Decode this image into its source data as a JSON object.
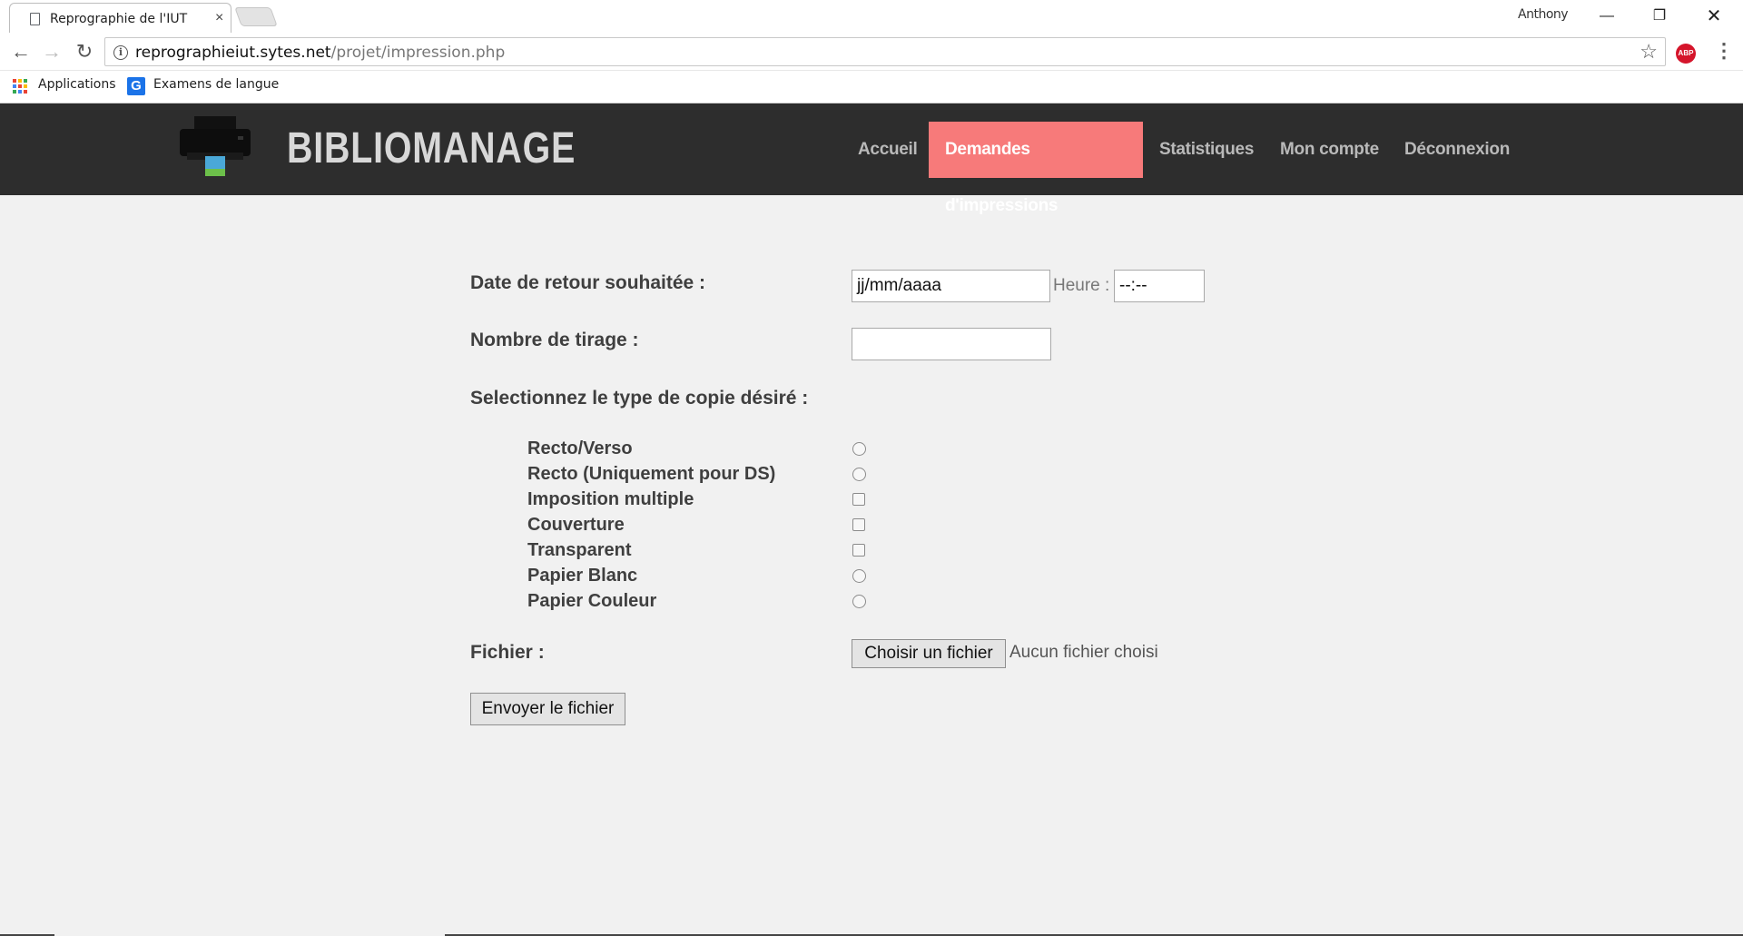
{
  "browser": {
    "tab_title": "Reprographie de l'IUT",
    "tab_close": "×",
    "profile_name": "Anthony",
    "url_host": "reprographieiut.sytes.net",
    "url_path": "/projet/impression.php",
    "bookmarks": [
      "Applications",
      "Examens de langue"
    ],
    "abp_label": "ABP"
  },
  "site": {
    "brand": "BIBLIOMANAGE",
    "nav": [
      "Accueil",
      "Demandes d'impressions",
      "Statistiques",
      "Mon compte",
      "Déconnexion"
    ],
    "active_nav": "Demandes d'impressions",
    "accent_color": "#f77a7a"
  },
  "form": {
    "date_label": "Date de retour souhaitée :",
    "date_value": "jj/mm/aaaa",
    "time_label": "Heure :",
    "time_value": "--:--",
    "count_label": "Nombre de tirage :",
    "count_value": "",
    "type_label": "Selectionnez le type de copie désiré :",
    "options": [
      {
        "label": "Recto/Verso",
        "control": "radio"
      },
      {
        "label": "Recto (Uniquement pour DS)",
        "control": "radio"
      },
      {
        "label": "Imposition multiple",
        "control": "checkbox"
      },
      {
        "label": "Couverture",
        "control": "checkbox"
      },
      {
        "label": "Transparent",
        "control": "checkbox"
      },
      {
        "label": "Papier Blanc",
        "control": "radio"
      },
      {
        "label": "Papier Couleur",
        "control": "radio"
      }
    ],
    "file_label": "Fichier :",
    "file_button": "Choisir un fichier",
    "file_status": "Aucun fichier choisi",
    "submit_label": "Envoyer le fichier"
  }
}
